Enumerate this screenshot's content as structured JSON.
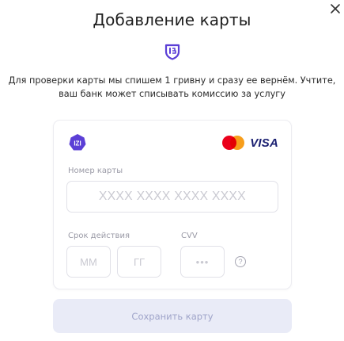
{
  "modal": {
    "title": "Добавление карты",
    "description_line1": "Для проверки карты мы спишем 1 гривну и сразу ее вернём. Учтите,",
    "description_line2": "ваш банк может списывать комиссию за услугу"
  },
  "card": {
    "logo_text": "IZI",
    "visa_label": "VISA",
    "number_label": "Номер карты",
    "number_placeholder": "XXXX XXXX XXXX XXXX",
    "expiry_label": "Срок действия",
    "month_placeholder": "ММ",
    "year_placeholder": "ГГ",
    "cvv_label": "CVV",
    "cvv_placeholder": "•••",
    "help_symbol": "?"
  },
  "actions": {
    "save_label": "Сохранить карту"
  },
  "colors": {
    "accent": "#5b3fd6",
    "button_bg": "#e9ebf7",
    "button_text": "#9fa4c9"
  },
  "icons": [
    "close-icon",
    "shield-icon",
    "izi-logo",
    "mastercard-logo",
    "visa-logo",
    "help-icon"
  ]
}
